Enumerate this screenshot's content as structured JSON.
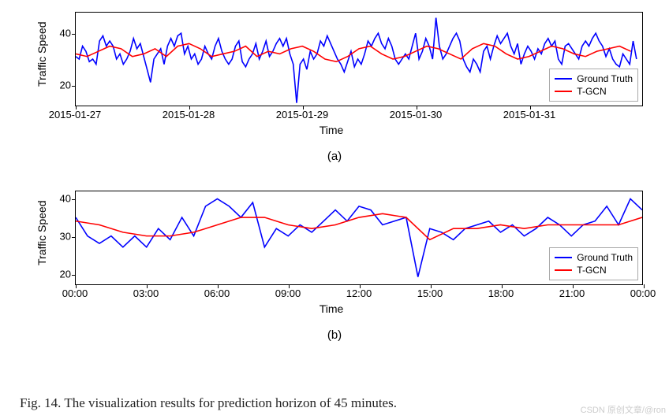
{
  "chart_data": [
    {
      "type": "line",
      "title": "",
      "xlabel": "Time",
      "ylabel": "Traffic Speed",
      "subplot_label": "(a)",
      "xticks": [
        "2015-01-27",
        "2015-01-28",
        "2015-01-29",
        "2015-01-30",
        "2015-01-31"
      ],
      "yticks": [
        20,
        40
      ],
      "ylim": [
        12,
        48
      ],
      "xlim": [
        0,
        5
      ],
      "legend": [
        "Ground Truth",
        "T-GCN"
      ],
      "legend_colors": [
        "#0000ff",
        "#ff0000"
      ],
      "series": [
        {
          "name": "Ground Truth",
          "color": "#0000ff",
          "x": [
            0.0,
            0.03,
            0.06,
            0.09,
            0.12,
            0.15,
            0.18,
            0.21,
            0.24,
            0.27,
            0.3,
            0.33,
            0.36,
            0.39,
            0.42,
            0.45,
            0.48,
            0.51,
            0.54,
            0.57,
            0.6,
            0.63,
            0.66,
            0.69,
            0.72,
            0.75,
            0.78,
            0.81,
            0.84,
            0.87,
            0.9,
            0.93,
            0.96,
            0.99,
            1.02,
            1.05,
            1.08,
            1.11,
            1.14,
            1.17,
            1.2,
            1.23,
            1.26,
            1.29,
            1.32,
            1.35,
            1.38,
            1.41,
            1.44,
            1.47,
            1.5,
            1.53,
            1.56,
            1.59,
            1.62,
            1.65,
            1.68,
            1.71,
            1.74,
            1.77,
            1.8,
            1.83,
            1.86,
            1.89,
            1.92,
            1.95,
            1.98,
            2.01,
            2.04,
            2.07,
            2.1,
            2.13,
            2.16,
            2.19,
            2.22,
            2.25,
            2.28,
            2.31,
            2.34,
            2.37,
            2.4,
            2.43,
            2.46,
            2.49,
            2.52,
            2.55,
            2.58,
            2.61,
            2.64,
            2.67,
            2.7,
            2.73,
            2.76,
            2.79,
            2.82,
            2.85,
            2.88,
            2.91,
            2.94,
            2.97,
            3.0,
            3.03,
            3.06,
            3.09,
            3.12,
            3.15,
            3.18,
            3.21,
            3.24,
            3.27,
            3.3,
            3.33,
            3.36,
            3.39,
            3.42,
            3.45,
            3.48,
            3.51,
            3.54,
            3.57,
            3.6,
            3.63,
            3.66,
            3.69,
            3.72,
            3.75,
            3.78,
            3.81,
            3.84,
            3.87,
            3.9,
            3.93,
            3.96,
            3.99,
            4.02,
            4.05,
            4.08,
            4.11,
            4.14,
            4.17,
            4.2,
            4.23,
            4.26,
            4.29,
            4.32,
            4.35,
            4.38,
            4.41,
            4.44,
            4.47,
            4.5,
            4.53,
            4.56,
            4.59,
            4.62,
            4.65,
            4.68,
            4.71,
            4.74,
            4.77,
            4.8,
            4.83,
            4.86,
            4.89,
            4.92,
            4.95
          ],
          "values": [
            31,
            30,
            35,
            33,
            29,
            30,
            28,
            37,
            39,
            35,
            37,
            35,
            30,
            32,
            28,
            30,
            33,
            38,
            34,
            36,
            31,
            26,
            21,
            30,
            32,
            34,
            28,
            35,
            38,
            35,
            39,
            40,
            32,
            35,
            30,
            32,
            28,
            30,
            35,
            32,
            30,
            35,
            38,
            33,
            30,
            28,
            30,
            35,
            37,
            29,
            27,
            30,
            32,
            36,
            30,
            33,
            37,
            31,
            33,
            36,
            38,
            35,
            38,
            32,
            28,
            13,
            28,
            30,
            26,
            33,
            30,
            32,
            37,
            35,
            39,
            36,
            33,
            30,
            28,
            25,
            29,
            33,
            27,
            30,
            28,
            32,
            37,
            35,
            38,
            40,
            36,
            34,
            38,
            35,
            30,
            28,
            30,
            32,
            30,
            35,
            40,
            30,
            33,
            38,
            35,
            30,
            46,
            35,
            30,
            32,
            35,
            38,
            40,
            37,
            30,
            27,
            25,
            30,
            28,
            25,
            33,
            35,
            30,
            35,
            39,
            36,
            38,
            40,
            35,
            32,
            36,
            28,
            32,
            35,
            33,
            30,
            34,
            32,
            36,
            38,
            35,
            37,
            30,
            28,
            35,
            36,
            34,
            32,
            30,
            35,
            37,
            35,
            38,
            40,
            37,
            35,
            31,
            34,
            30,
            28,
            27,
            32,
            30,
            28,
            37,
            30
          ]
        },
        {
          "name": "T-GCN",
          "color": "#ff0000",
          "x": [
            0.0,
            0.1,
            0.2,
            0.3,
            0.4,
            0.5,
            0.6,
            0.7,
            0.8,
            0.9,
            1.0,
            1.1,
            1.2,
            1.3,
            1.4,
            1.5,
            1.6,
            1.7,
            1.8,
            1.9,
            2.0,
            2.1,
            2.2,
            2.3,
            2.4,
            2.5,
            2.6,
            2.7,
            2.8,
            2.9,
            3.0,
            3.1,
            3.2,
            3.3,
            3.4,
            3.5,
            3.6,
            3.7,
            3.8,
            3.9,
            4.0,
            4.1,
            4.2,
            4.3,
            4.4,
            4.5,
            4.6,
            4.7,
            4.8,
            4.9
          ],
          "values": [
            32,
            31,
            33,
            35,
            34,
            31,
            32,
            34,
            31,
            35,
            36,
            34,
            31,
            32,
            33,
            35,
            31,
            33,
            32,
            34,
            35,
            33,
            30,
            29,
            31,
            34,
            35,
            32,
            30,
            31,
            33,
            35,
            34,
            32,
            30,
            34,
            36,
            35,
            32,
            30,
            31,
            33,
            35,
            34,
            32,
            31,
            33,
            34,
            35,
            33
          ]
        }
      ]
    },
    {
      "type": "line",
      "title": "",
      "xlabel": "Time",
      "ylabel": "Traffic Speed",
      "subplot_label": "(b)",
      "xticks": [
        "00:00",
        "03:00",
        "06:00",
        "09:00",
        "12:00",
        "15:00",
        "18:00",
        "21:00",
        "00:00"
      ],
      "yticks": [
        20,
        30,
        40
      ],
      "ylim": [
        17,
        42
      ],
      "xlim": [
        0,
        24
      ],
      "legend": [
        "Ground Truth",
        "T-GCN"
      ],
      "legend_colors": [
        "#0000ff",
        "#ff0000"
      ],
      "series": [
        {
          "name": "Ground Truth",
          "color": "#0000ff",
          "x": [
            0.0,
            0.5,
            1.0,
            1.5,
            2.0,
            2.5,
            3.0,
            3.5,
            4.0,
            4.5,
            5.0,
            5.5,
            6.0,
            6.5,
            7.0,
            7.5,
            8.0,
            8.5,
            9.0,
            9.5,
            10.0,
            10.5,
            11.0,
            11.5,
            12.0,
            12.5,
            13.0,
            13.5,
            14.0,
            14.5,
            15.0,
            15.5,
            16.0,
            16.5,
            17.0,
            17.5,
            18.0,
            18.5,
            19.0,
            19.5,
            20.0,
            20.5,
            21.0,
            21.5,
            22.0,
            22.5,
            23.0,
            23.5,
            24.0
          ],
          "values": [
            35,
            30,
            28,
            30,
            27,
            30,
            27,
            32,
            29,
            35,
            30,
            38,
            40,
            38,
            35,
            39,
            27,
            32,
            30,
            33,
            31,
            34,
            37,
            34,
            38,
            37,
            33,
            34,
            35,
            19,
            32,
            31,
            29,
            32,
            33,
            34,
            31,
            33,
            30,
            32,
            35,
            33,
            30,
            33,
            34,
            38,
            33,
            40,
            37
          ]
        },
        {
          "name": "T-GCN",
          "color": "#ff0000",
          "x": [
            0.0,
            1.0,
            2.0,
            3.0,
            4.0,
            5.0,
            6.0,
            7.0,
            8.0,
            9.0,
            10.0,
            11.0,
            12.0,
            13.0,
            14.0,
            15.0,
            16.0,
            17.0,
            18.0,
            19.0,
            20.0,
            21.0,
            22.0,
            23.0,
            24.0
          ],
          "values": [
            34,
            33,
            31,
            30,
            30,
            31,
            33,
            35,
            35,
            33,
            32,
            33,
            35,
            36,
            35,
            29,
            32,
            32,
            33,
            32,
            33,
            33,
            33,
            33,
            35
          ]
        }
      ]
    }
  ],
  "caption": "Fig. 14.   The visualization results for prediction horizon of 45 minutes.",
  "watermark": "CSDN 原创文章/@ron"
}
